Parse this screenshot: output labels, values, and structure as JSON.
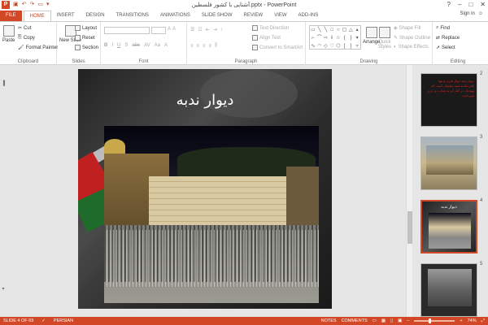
{
  "app": {
    "title": "آشنایی با کشور فلسطین.pptx - PowerPoint",
    "signin": "Sign in",
    "window_controls": [
      "?",
      "–",
      "□",
      "✕"
    ]
  },
  "tabs": [
    "FILE",
    "HOME",
    "INSERT",
    "DESIGN",
    "TRANSITIONS",
    "ANIMATIONS",
    "SLIDE SHOW",
    "REVIEW",
    "VIEW",
    "ADD-INS"
  ],
  "active_tab": "HOME",
  "ribbon": {
    "clipboard": {
      "label": "Clipboard",
      "paste": "Paste",
      "cut": "Cut",
      "copy": "Copy",
      "format_painter": "Format Painter"
    },
    "slides": {
      "label": "Slides",
      "new_slide": "New Slide",
      "layout": "Layout",
      "reset": "Reset",
      "section": "Section"
    },
    "font": {
      "label": "Font",
      "buttons": [
        "B",
        "I",
        "U",
        "S",
        "abc",
        "AV",
        "Aa",
        "A"
      ]
    },
    "paragraph": {
      "label": "Paragraph",
      "text_direction": "Text Direction",
      "align_text": "Align Text",
      "convert_smartart": "Convert to SmartArt"
    },
    "drawing": {
      "label": "Drawing",
      "arrange": "Arrange",
      "quick_styles": "Quick Styles",
      "shape_fill": "Shape Fill",
      "shape_outline": "Shape Outline",
      "shape_effects": "Shape Effects"
    },
    "editing": {
      "label": "Editing",
      "find": "Find",
      "replace": "Replace",
      "select": "Select"
    }
  },
  "slide": {
    "title": "دیوار ندبه"
  },
  "thumbnails": [
    {
      "number": "2",
      "text": "دیوار ندبه دیوار غربی و تنها باقی‌مانده معبد سلیمان است که یهودیان در کنار آن به عبادت و زاری میپردازند"
    },
    {
      "number": "3",
      "text": ""
    },
    {
      "number": "4",
      "text": "دیوار ندبه"
    },
    {
      "number": "5",
      "text": ""
    }
  ],
  "status": {
    "slide_info": "SLIDE 4 OF 69",
    "language": "PERSIAN",
    "notes": "NOTES",
    "comments": "COMMENTS",
    "zoom": "74%"
  },
  "colors": {
    "accent": "#d24726"
  }
}
